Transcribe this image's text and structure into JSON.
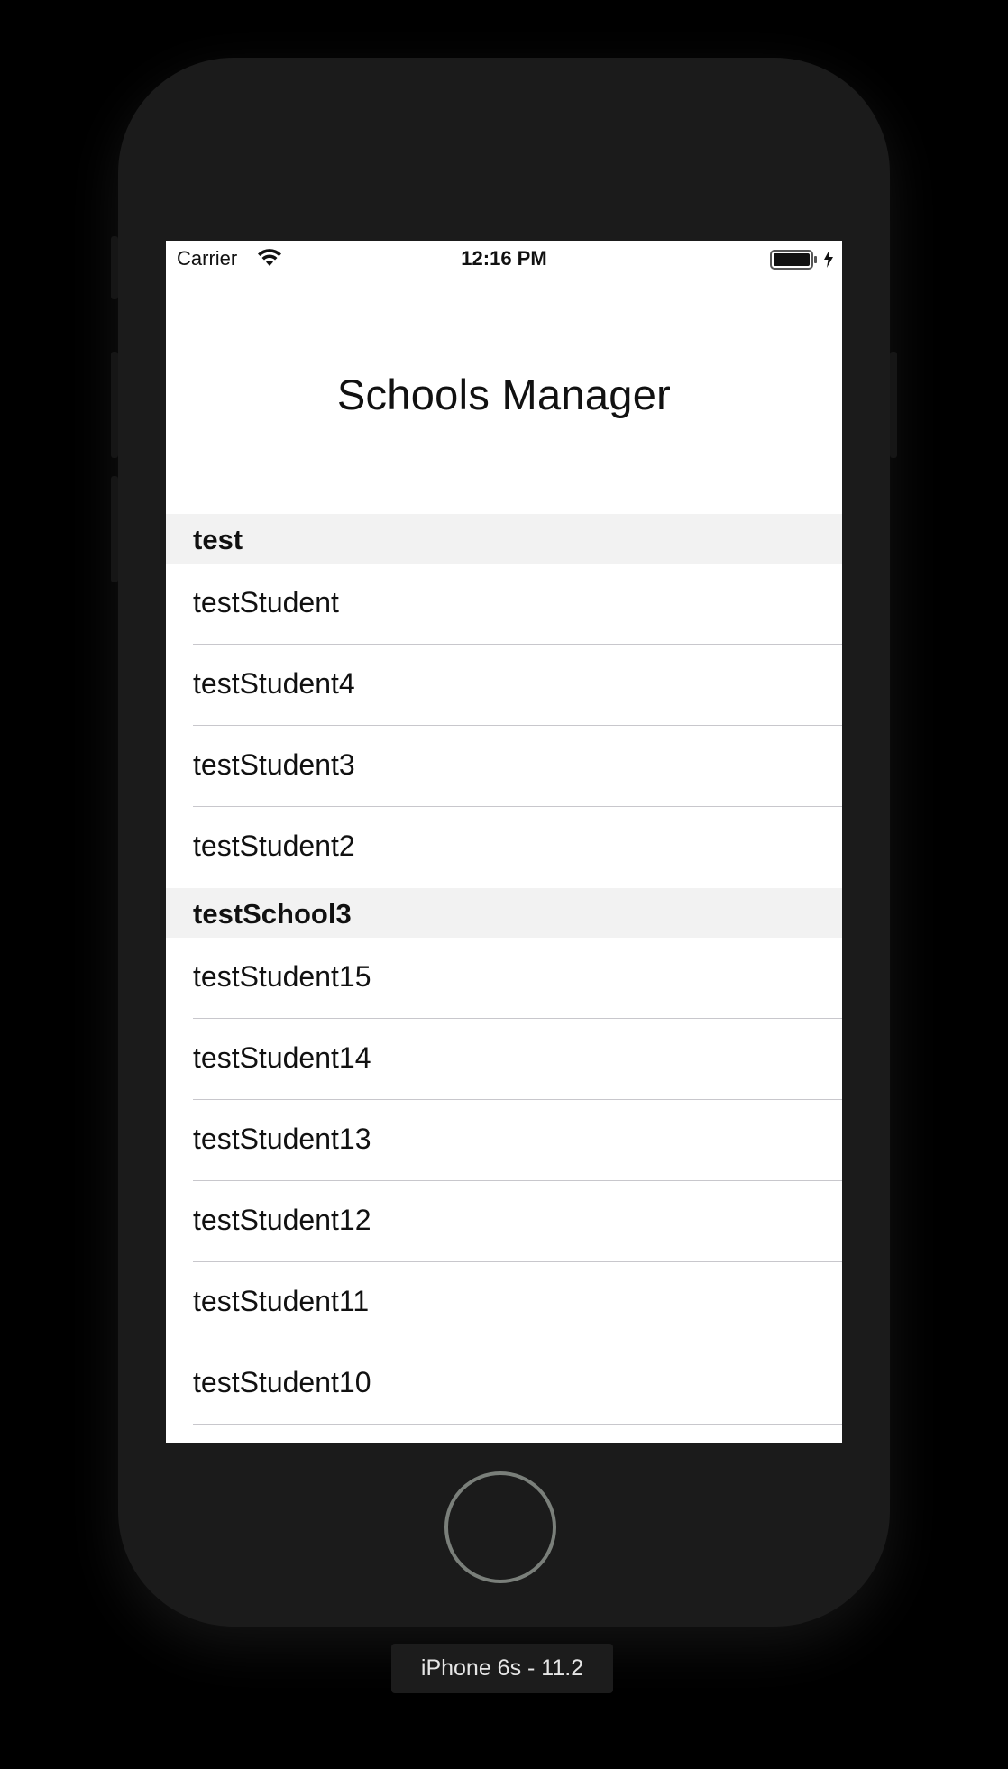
{
  "status_bar": {
    "carrier": "Carrier",
    "time": "12:16 PM",
    "icons": [
      "wifi-icon",
      "battery-icon",
      "charging-bolt-icon"
    ]
  },
  "nav": {
    "title": "Schools Manager"
  },
  "sections": [
    {
      "header": "test",
      "rows": [
        "testStudent",
        "testStudent4",
        "testStudent3",
        "testStudent2"
      ]
    },
    {
      "header": "testSchool3",
      "rows": [
        "testStudent15",
        "testStudent14",
        "testStudent13",
        "testStudent12",
        "testStudent11",
        "testStudent10"
      ]
    }
  ],
  "device_label": "iPhone 6s - 11.2",
  "colors": {
    "background": "#000000",
    "phone_body": "#1b1b1b",
    "screen": "#ffffff",
    "section_header": "#f2f2f2",
    "separator": "#c8c7cc",
    "home_ring": "#7a7f7a"
  }
}
